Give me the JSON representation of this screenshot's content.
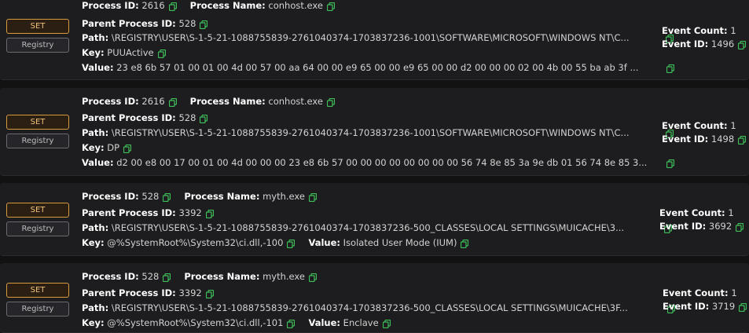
{
  "labels": {
    "process_id": "Process ID:",
    "process_name": "Process Name:",
    "parent_process_id": "Parent Process ID:",
    "path": "Path:",
    "key": "Key:",
    "value": "Value:",
    "event_count": "Event Count:",
    "event_id": "Event ID:"
  },
  "badges": {
    "set": "SET",
    "registry": "Registry"
  },
  "colors": {
    "accent_copy": "#3fbf5a",
    "set_border": "#d59b3c",
    "set_text": "#f2c27a"
  },
  "icons": {
    "copy": "copy-icon"
  },
  "events": [
    {
      "process_id": "2616",
      "process_name": "conhost.exe",
      "parent_process_id": "528",
      "path": "\\REGISTRY\\USER\\S-1-5-21-1088755839-2761040374-1703837236-1001\\SOFTWARE\\MICROSOFT\\WINDOWS NT\\C...",
      "key": "PUUActive",
      "value": "23 e8 6b 57 01 00 01 00 4d 00 57 00 aa 64 00 00 e9 65 00 00 e9 65 00 00 d2 00 00 00 02 00 4b 00 55 ba ab 3f ...",
      "event_count": "1",
      "event_id": "1496"
    },
    {
      "process_id": "2616",
      "process_name": "conhost.exe",
      "parent_process_id": "528",
      "path": "\\REGISTRY\\USER\\S-1-5-21-1088755839-2761040374-1703837236-1001\\SOFTWARE\\MICROSOFT\\WINDOWS NT\\C...",
      "key": "DP",
      "value": "d2 00 e8 00 17 00 01 00 4d 00 00 00 23 e8 6b 57 00 00 00 00 00 00 00 00 56 74 8e 85 3a 9e db 01 56 74 8e 85 3...",
      "event_count": "1",
      "event_id": "1498"
    },
    {
      "process_id": "528",
      "process_name": "myth.exe",
      "parent_process_id": "3392",
      "path": "\\REGISTRY\\USER\\S-1-5-21-1088755839-2761040374-1703837236-500_CLASSES\\LOCAL SETTINGS\\MUICACHE\\3...",
      "key": "@%SystemRoot%\\System32\\ci.dll,-100",
      "value": "Isolated User Mode (IUM)",
      "event_count": "1",
      "event_id": "3692"
    },
    {
      "process_id": "528",
      "process_name": "myth.exe",
      "parent_process_id": "3392",
      "path": "\\REGISTRY\\USER\\S-1-5-21-1088755839-2761040374-1703837236-500_CLASSES\\LOCAL SETTINGS\\MUICACHE\\3F...",
      "key": "@%SystemRoot%\\System32\\ci.dll,-101",
      "value": "Enclave",
      "event_count": "1",
      "event_id": "3719"
    }
  ]
}
